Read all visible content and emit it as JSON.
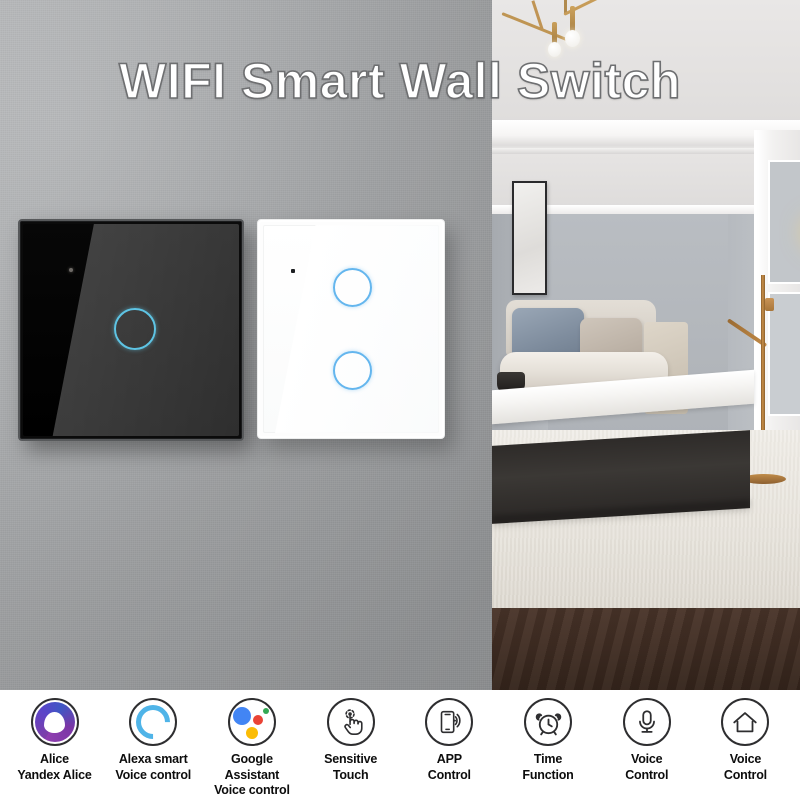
{
  "hero": {
    "title": "WIFI Smart Wall Switch",
    "scene_description": "Grey textured wall on the left with two glass touch wall switches mounted, modern grey living room with sofa, coffee table, rug and brass floor lamp on the right",
    "products": [
      {
        "name": "black-glass-touch-switch",
        "color": "#0b0b0b",
        "gangs": 1,
        "indicator_color": "#5ec4e4",
        "has_led_dot": true
      },
      {
        "name": "white-glass-touch-switch",
        "color": "#fdfdfd",
        "gangs": 2,
        "indicator_color": "#64b6ee",
        "has_led_dot": true
      }
    ],
    "room": {
      "chandelier": "brass-chandelier",
      "floor_lamp": "brass-floor-lamp",
      "wall_art": "framed-picture",
      "sofa": "light-grey-sofa",
      "coffee_table": "marble-top-dark-base-table",
      "rug": "cream-rug",
      "floor": "dark-wood-floor"
    },
    "wall_color": "#a9abad"
  },
  "features": [
    {
      "icon": "alice-yandex-icon",
      "line1": "Alice",
      "line2": "Yandex Alice",
      "accent": "#7b3fa8"
    },
    {
      "icon": "alexa-icon",
      "line1": "Alexa smart",
      "line2": "Voice control",
      "accent": "#4fb4e8"
    },
    {
      "icon": "google-assistant-icon",
      "line1": "Google Assistant",
      "line2": "Voice control",
      "accent": "#4285f4"
    },
    {
      "icon": "sensitive-touch-icon",
      "line1": "Sensitive",
      "line2": "Touch",
      "accent": "#2e2e30"
    },
    {
      "icon": "app-control-icon",
      "line1": "APP",
      "line2": "Control",
      "accent": "#2e2e30"
    },
    {
      "icon": "time-function-icon",
      "line1": "Time",
      "line2": "Function",
      "accent": "#2e2e30"
    },
    {
      "icon": "voice-control-mic-icon",
      "line1": "Voice",
      "line2": "Control",
      "accent": "#2e2e30"
    },
    {
      "icon": "voice-control-home-icon",
      "line1": "Voice",
      "line2": "Control",
      "accent": "#2e2e30"
    }
  ]
}
